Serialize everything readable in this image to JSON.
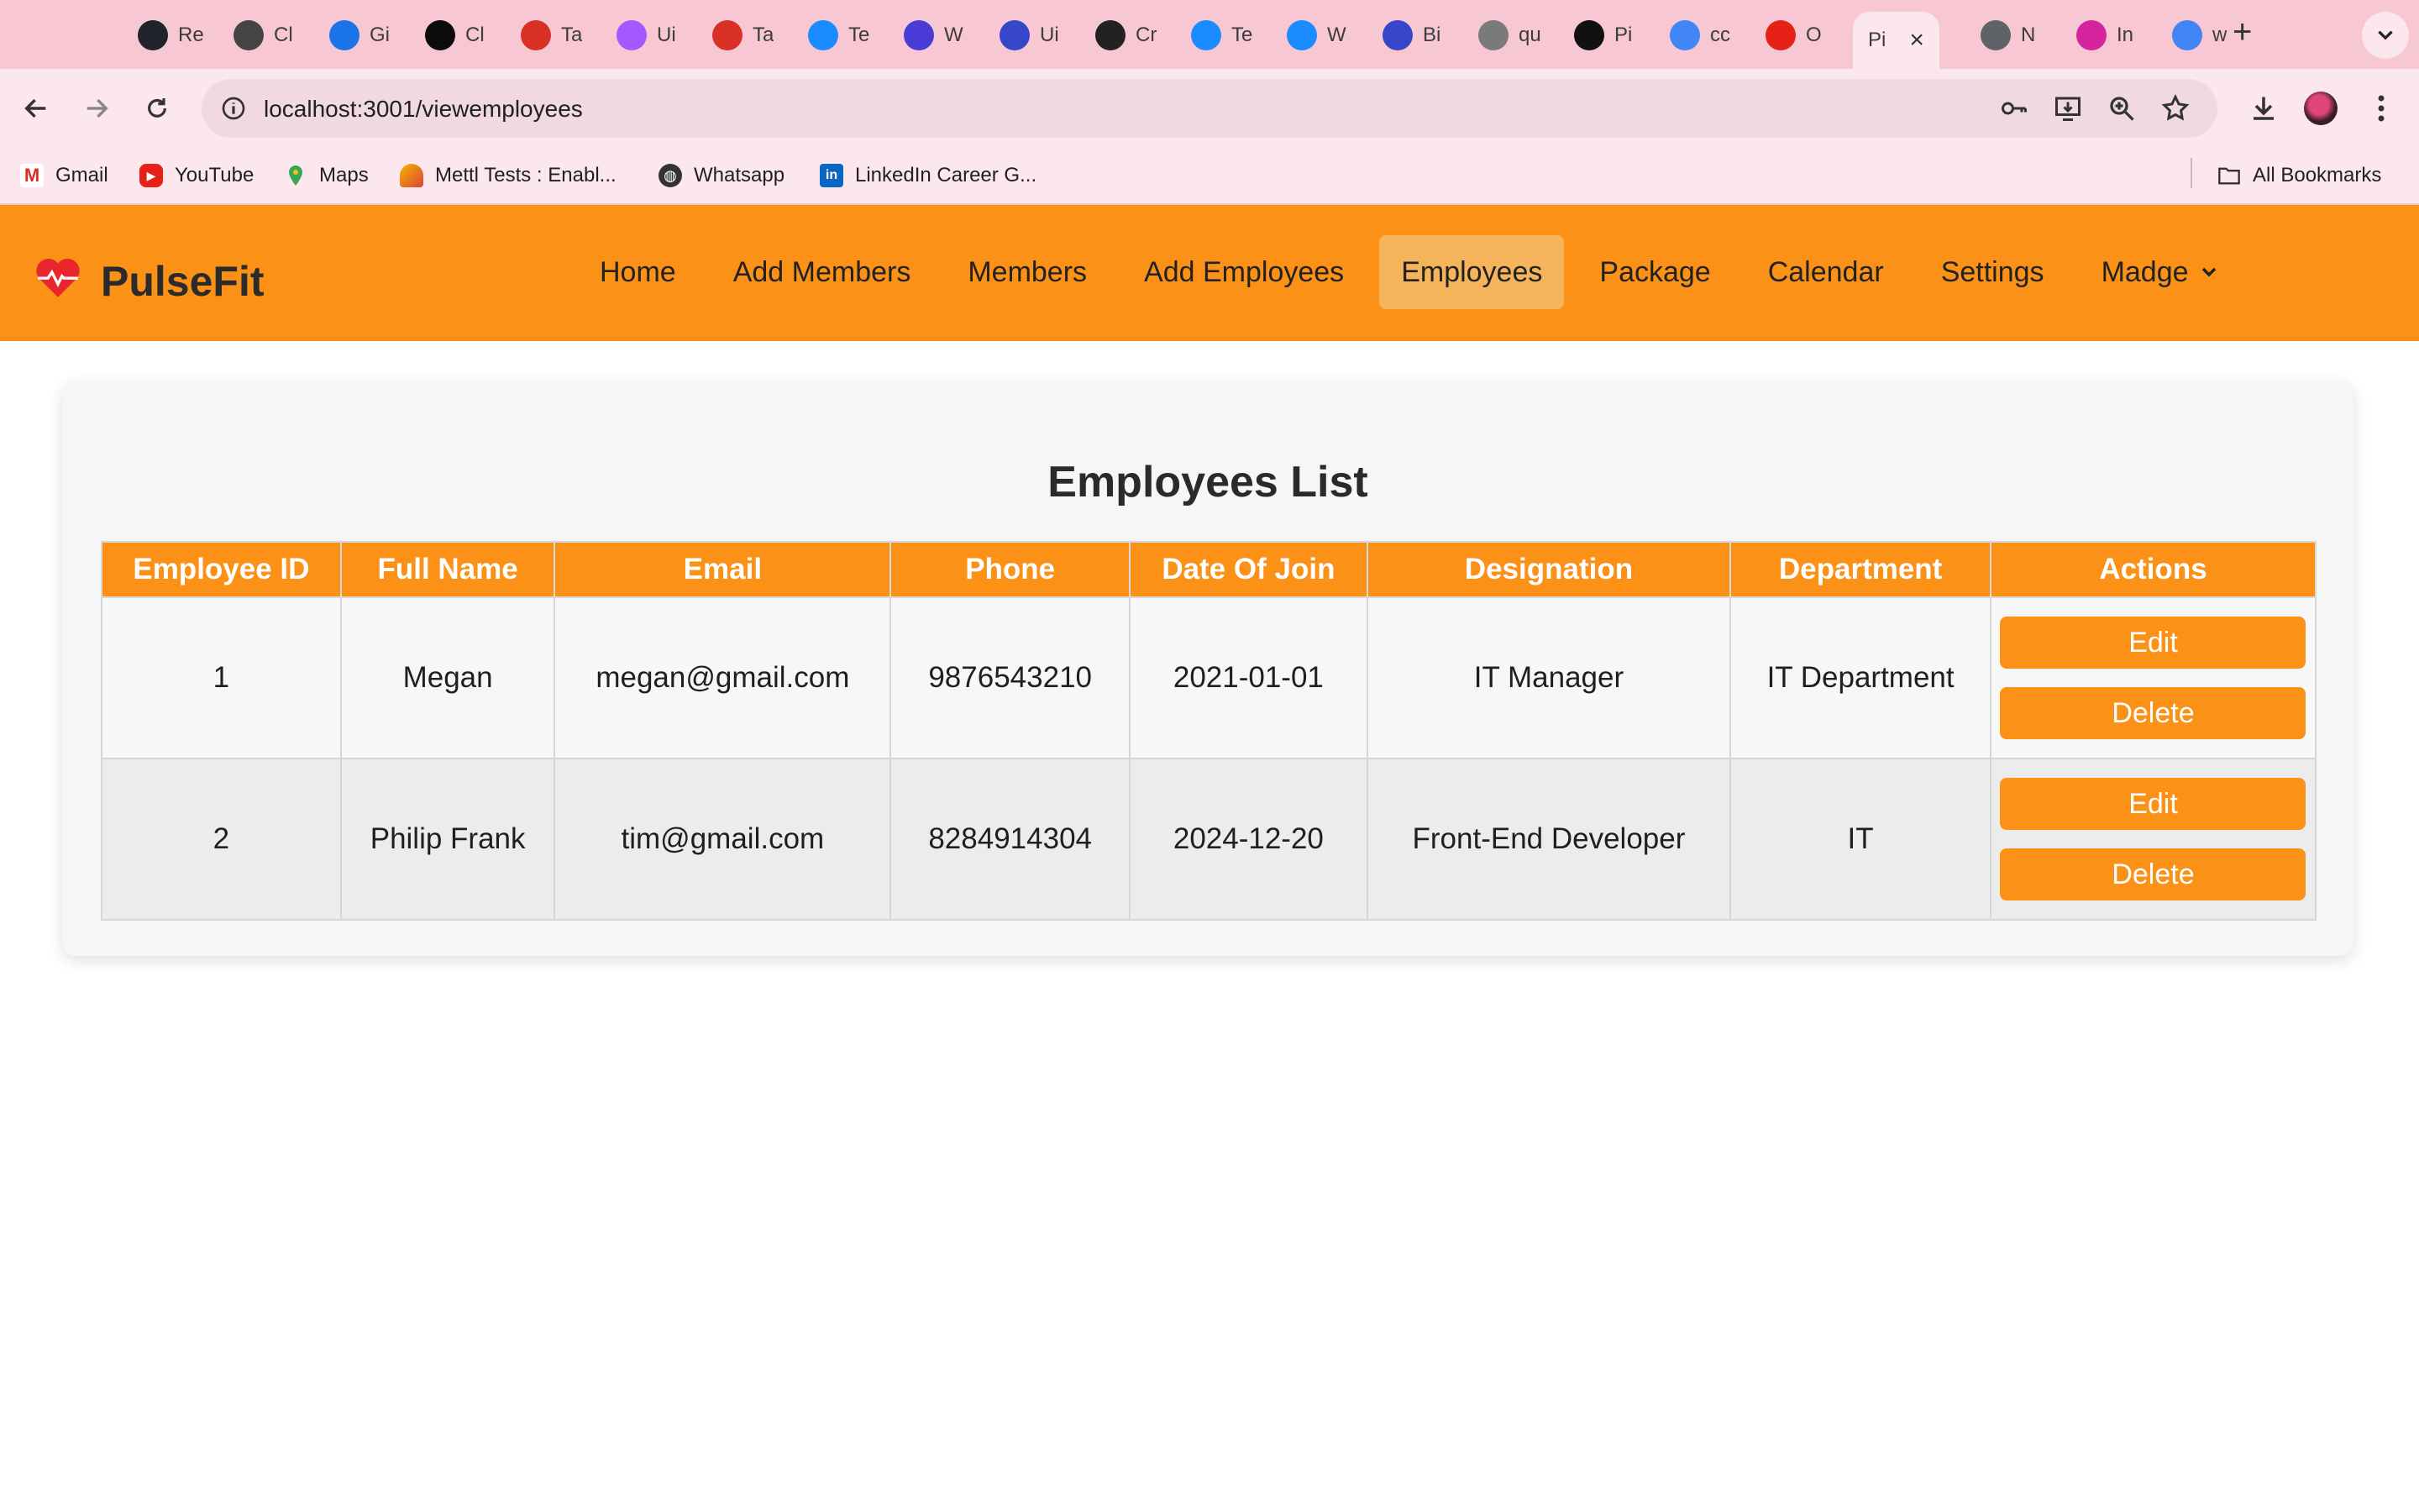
{
  "browser": {
    "tabs": [
      {
        "title": "Re",
        "icon": "react-icon",
        "color": "#20232a"
      },
      {
        "title": "Cl",
        "icon": "chatgpt-icon",
        "color": "#444444"
      },
      {
        "title": "Gi",
        "icon": "calendar-icon",
        "color": "#1a73e8"
      },
      {
        "title": "Cl",
        "icon": "mongodb-icon",
        "color": "#0b0b0b"
      },
      {
        "title": "Ta",
        "icon": "gmail-icon",
        "color": "#d93025"
      },
      {
        "title": "Ui",
        "icon": "figma-icon",
        "color": "#a259ff"
      },
      {
        "title": "Ta",
        "icon": "gmail-icon",
        "color": "#d93025"
      },
      {
        "title": "Te",
        "icon": "canva-icon",
        "color": "#1a8cff"
      },
      {
        "title": "W",
        "icon": "video-icon",
        "color": "#4a3bd6"
      },
      {
        "title": "Ui",
        "icon": "app-icon",
        "color": "#3547c8"
      },
      {
        "title": "Cr",
        "icon": "pinterest-icon",
        "color": "#222222"
      },
      {
        "title": "Te",
        "icon": "canva-icon",
        "color": "#1a8cff"
      },
      {
        "title": "W",
        "icon": "canva-icon",
        "color": "#1a8cff"
      },
      {
        "title": "Bi",
        "icon": "app-icon",
        "color": "#3547c8"
      },
      {
        "title": "qu",
        "icon": "google-icon",
        "color": "#7a7a7a"
      },
      {
        "title": "Pi",
        "icon": "github-icon",
        "color": "#111111"
      },
      {
        "title": "cc",
        "icon": "google-icon",
        "color": "#4285f4"
      },
      {
        "title": "O",
        "icon": "youtube-icon",
        "color": "#e62117"
      },
      {
        "title": "Pi",
        "icon": "pulsefit-icon",
        "color": "#e62117",
        "active": true
      },
      {
        "title": "N",
        "icon": "chrome-icon",
        "color": "#5f6368"
      },
      {
        "title": "In",
        "icon": "instagram-icon",
        "color": "#d6249f"
      },
      {
        "title": "w",
        "icon": "google-icon",
        "color": "#4285f4"
      }
    ],
    "url": "localhost:3001/viewemployees",
    "bookmarks": [
      {
        "label": "Gmail",
        "icon": "gmail-icon"
      },
      {
        "label": "YouTube",
        "icon": "youtube-icon"
      },
      {
        "label": "Maps",
        "icon": "maps-icon"
      },
      {
        "label": "Mettl Tests : Enabl...",
        "icon": "mettl-icon"
      },
      {
        "label": "Whatsapp",
        "icon": "globe-icon"
      },
      {
        "label": "LinkedIn Career G...",
        "icon": "linkedin-icon"
      }
    ],
    "all_bookmarks": "All Bookmarks"
  },
  "app": {
    "brand": "PulseFit",
    "nav": [
      "Home",
      "Add Members",
      "Members",
      "Add Employees",
      "Employees",
      "Package",
      "Calendar",
      "Settings"
    ],
    "active_nav": "Employees",
    "user": "Madge",
    "accent": "#fb9116"
  },
  "page": {
    "title": "Employees List",
    "columns": [
      "Employee ID",
      "Full Name",
      "Email",
      "Phone",
      "Date Of Join",
      "Designation",
      "Department",
      "Actions"
    ],
    "rows": [
      {
        "id": "1",
        "name": "Megan",
        "email": "megan@gmail.com",
        "phone": "9876543210",
        "doj": "2021-01-01",
        "designation": "IT Manager",
        "department": "IT Department"
      },
      {
        "id": "2",
        "name": "Philip Frank",
        "email": "tim@gmail.com",
        "phone": "8284914304",
        "doj": "2024-12-20",
        "designation": "Front-End Developer",
        "department": "IT"
      }
    ],
    "edit_label": "Edit",
    "delete_label": "Delete"
  }
}
